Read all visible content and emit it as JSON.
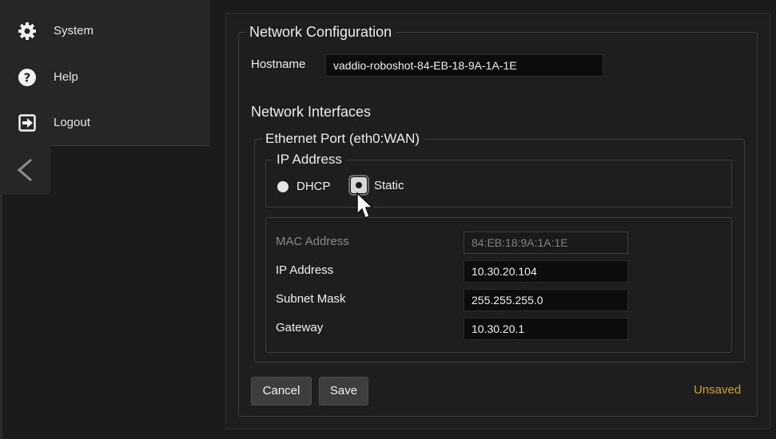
{
  "sidebar": {
    "items": [
      {
        "label": "System",
        "icon": "gear-icon"
      },
      {
        "label": "Help",
        "icon": "help-icon"
      },
      {
        "label": "Logout",
        "icon": "logout-icon"
      }
    ],
    "collapse_icon": "chevron-left-icon"
  },
  "network_config": {
    "title": "Network Configuration",
    "hostname_label": "Hostname",
    "hostname_value": "vaddio-roboshot-84-EB-18-9A-1A-1E",
    "interfaces_title": "Network Interfaces",
    "ethernet": {
      "title": "Ethernet Port (eth0:WAN)",
      "ip_mode": {
        "title": "IP Address",
        "options": [
          {
            "label": "DHCP",
            "selected": false
          },
          {
            "label": "Static",
            "selected": true
          }
        ]
      },
      "fields": {
        "mac_label": "MAC Address",
        "mac_value": "84:EB:18:9A:1A:1E",
        "ip_label": "IP Address",
        "ip_value": "10.30.20.104",
        "subnet_label": "Subnet Mask",
        "subnet_value": "255.255.255.0",
        "gateway_label": "Gateway",
        "gateway_value": "10.30.20.1"
      }
    }
  },
  "actions": {
    "cancel_label": "Cancel",
    "save_label": "Save",
    "status": "Unsaved"
  },
  "colors": {
    "background": "#1b1b1b",
    "sidebar": "#262626",
    "status_unsaved": "#c9a227"
  }
}
